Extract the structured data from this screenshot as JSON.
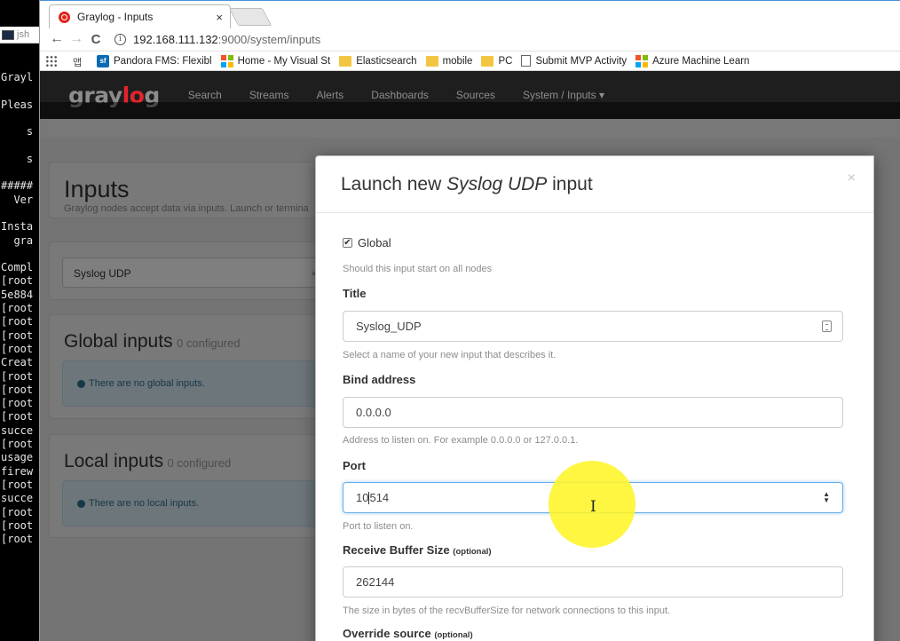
{
  "terminal": {
    "title": "jsh",
    "lines": [
      "Grayl",
      "",
      "Pleas",
      "",
      "    s",
      "",
      "    s",
      "",
      "#####",
      "  Ver",
      "",
      "Insta",
      "  gra",
      "",
      "Compl",
      "[root",
      "5e884",
      "[root",
      "[root",
      "[root",
      "[root",
      "Creat",
      "[root",
      "[root",
      "[root",
      "[root",
      "succe",
      "[root",
      "usage",
      "firew",
      "[root",
      "succe",
      "[root",
      "[root",
      "[root"
    ]
  },
  "browser": {
    "tab_title": "Graylog - Inputs",
    "tab_close": "×",
    "back": "←",
    "forward": "→",
    "reload": "C",
    "address_host": "192.168.111.132",
    "address_path": ":9000/system/inputs",
    "bookmarks": [
      {
        "icon": "apps-icon",
        "label": ""
      },
      {
        "icon": "korean-glyph-icon",
        "label": ""
      },
      {
        "icon": "sf-icon",
        "label": "Pandora FMS: Flexibl"
      },
      {
        "icon": "ms-icon",
        "label": "Home - My Visual St"
      },
      {
        "icon": "folder-icon",
        "label": "Elasticsearch"
      },
      {
        "icon": "folder-icon",
        "label": "mobile"
      },
      {
        "icon": "folder-icon",
        "label": "PC"
      },
      {
        "icon": "doc-icon",
        "label": "Submit MVP Activity"
      },
      {
        "icon": "ms-icon",
        "label": "Azure Machine Learn"
      }
    ]
  },
  "graylog": {
    "logo_pre": "gray",
    "logo_o": "lo",
    "logo_post": "g",
    "menu": [
      "Search",
      "Streams",
      "Alerts",
      "Dashboards",
      "Sources",
      "System / Inputs ▾"
    ]
  },
  "page": {
    "title": "Inputs",
    "subtitle": "Graylog nodes accept data via inputs. Launch or termina",
    "select_value": "Syslog UDP",
    "select_clear": "×",
    "select_caret": "▾",
    "global_title": "Global inputs",
    "global_count": "0 configured",
    "global_empty": "There are no global inputs.",
    "local_title": "Local inputs",
    "local_count": "0 configured",
    "local_empty": "There are no local inputs."
  },
  "modal": {
    "title_pre": "Launch new ",
    "title_em": "Syslog UDP",
    "title_post": " input",
    "close": "×",
    "global_label": "Global",
    "global_checked": true,
    "global_help": "Should this input start on all nodes",
    "title_label": "Title",
    "title_value": "Syslog_UDP",
    "title_help": "Select a name of your new input that describes it.",
    "bind_label": "Bind address",
    "bind_value": "0.0.0.0",
    "bind_help": "Address to listen on. For example 0.0.0.0 or 127.0.0.1.",
    "port_label": "Port",
    "port_value_a": "10",
    "port_value_b": "514",
    "port_help": "Port to listen on.",
    "recv_label": "Receive Buffer Size",
    "recv_optional": "(optional)",
    "recv_value": "262144",
    "recv_help": "The size in bytes of the recvBufferSize for network connections to this input.",
    "override_label": "Override source",
    "override_optional": "(optional)"
  },
  "colors": {
    "graylog_red": "#e3242b",
    "navbar": "#1e1e1e",
    "info_bg": "#d9edf7",
    "cursor_highlight": "#fff528"
  }
}
